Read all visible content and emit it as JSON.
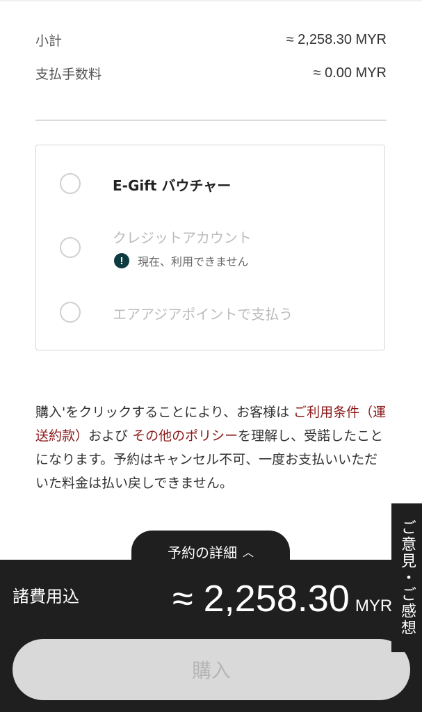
{
  "summary": {
    "subtotal_label": "小計",
    "subtotal_value": "≈ 2,258.30 MYR",
    "fee_label": "支払手数料",
    "fee_value": "≈ 0.00  MYR"
  },
  "payment_options": {
    "egift_label": "E-Gift バウチャー",
    "credit_label": "クレジットアカウント",
    "credit_note": "現在、利用できません",
    "airasia_label": "エアアジアポイントで支払う"
  },
  "terms": {
    "part1": "購入'をクリックすることにより、お客様は ",
    "link1": "ご利用条件（運送約款）",
    "part2": "および ",
    "link2": "その他のポリシー",
    "part3": "を理解し、受諾したことになります。予約はキャンセル不可、一度お支払いいただいた料金は払い戻しできません。"
  },
  "bottom_bar": {
    "details_tab": "予約の詳細",
    "total_label": "諸費用込",
    "total_amount": "≈ 2,258.30",
    "total_currency": "MYR",
    "buy_button": "購入"
  },
  "feedback_tab": "ご意見・ご感想",
  "colors": {
    "link": "#8b1a1a",
    "bar": "#1f1f1f",
    "warn": "#0d3b3f"
  },
  "icons": {
    "warning": "exclamation-circle-icon",
    "chevron": "chevron-up-icon"
  }
}
